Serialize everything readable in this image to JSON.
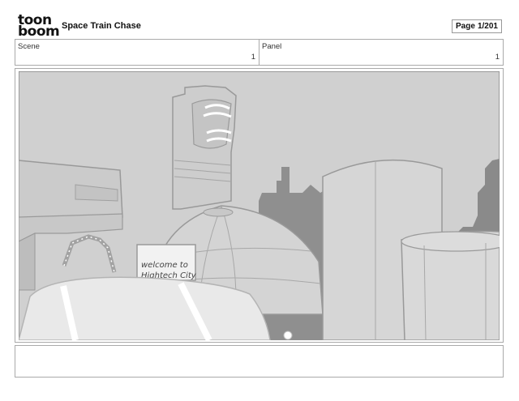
{
  "header": {
    "logo_line1": "toon",
    "logo_line2": "boom",
    "project_title": "Space Train Chase",
    "page_label": "Page",
    "page_value": "1/201"
  },
  "meta": {
    "scene_label": "Scene",
    "scene_value": "1",
    "panel_label": "Panel",
    "panel_value": "1"
  },
  "drawing": {
    "sign_line1": "welcome to",
    "sign_line2": "Hightech City"
  },
  "colors": {
    "sky": "#cfcfcf",
    "dark_buildings": "#8e8e8e",
    "line": "#9a9a9a",
    "highlight": "#ffffff"
  }
}
